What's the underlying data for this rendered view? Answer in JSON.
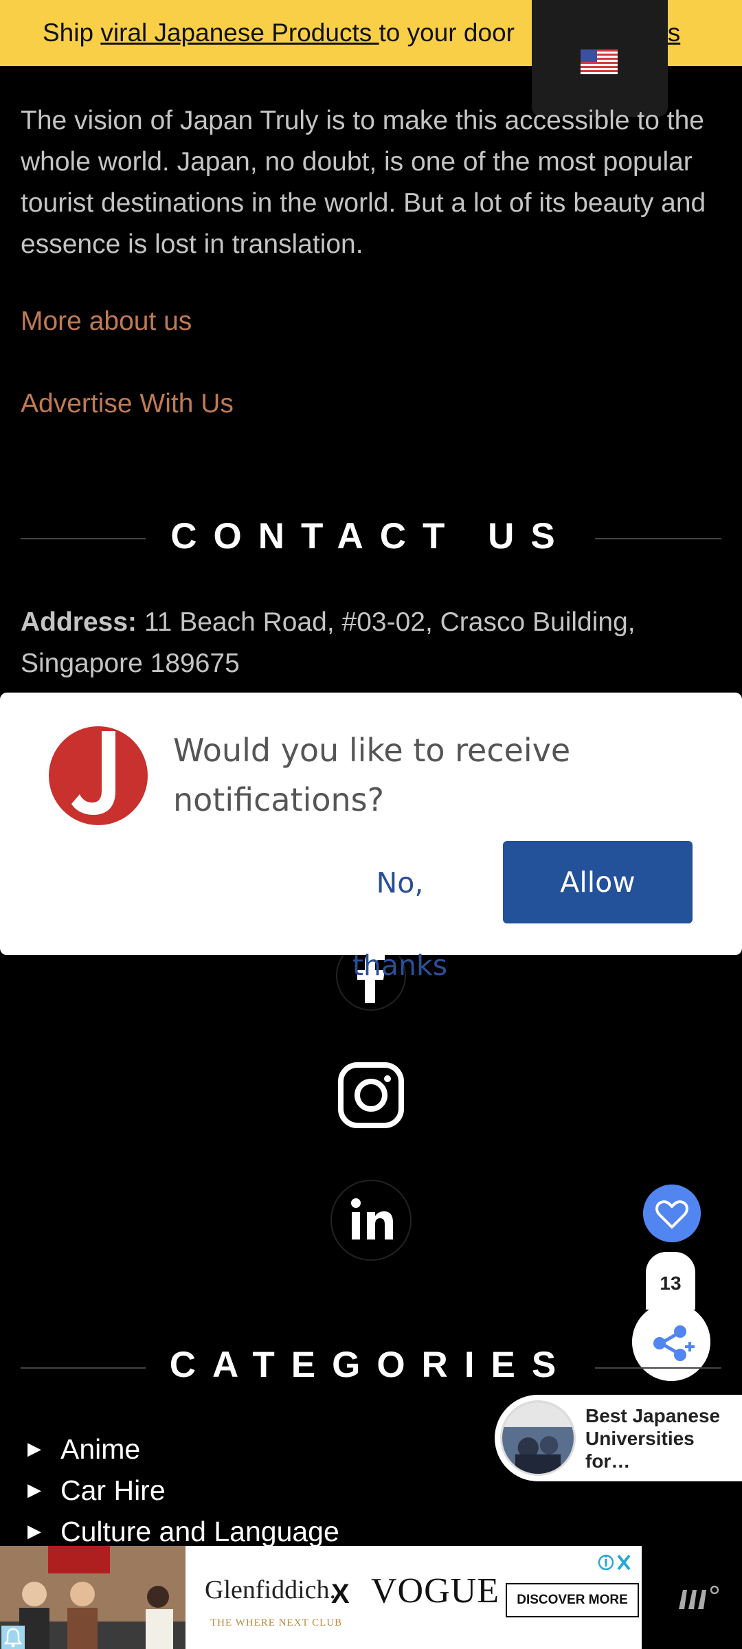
{
  "promo": {
    "prefix": "Ship ",
    "link": "viral Japanese Products ",
    "middle": "to your door",
    "suffix": "iss"
  },
  "language": {
    "flag": "us-flag-icon"
  },
  "about": {
    "vision": "The vision of Japan Truly is to make this accessible to the whole world. Japan, no doubt, is one of the most popular tourist destinations in the world. But a lot of its beauty and essence is lost in translation.",
    "more_about": "More about us",
    "advertise": "Advertise With Us"
  },
  "contact": {
    "title": "CONTACT US",
    "address_label": "Address:",
    "address_value": "11 Beach Road, #03-02, Crasco Building, Singapore 189675"
  },
  "notification": {
    "message": "Would you like to receive notifications?",
    "decline": "No, thanks",
    "accept": "Allow",
    "colors": {
      "accept_bg": "#23519a",
      "logo": "#c8312e"
    }
  },
  "social": [
    "facebook-icon",
    "instagram-icon",
    "linkedin-icon"
  ],
  "floating": {
    "like_count": "13"
  },
  "categories": {
    "title": "CATEGORIES",
    "items": [
      "Anime",
      "Car Hire",
      "Culture and Language"
    ]
  },
  "related": {
    "title": "Best Japanese Universities for…"
  },
  "ad": {
    "brand": "Glenfiddich.",
    "brand_sub": "THE WHERE NEXT CLUB",
    "x": "X",
    "partner": "VOGUE",
    "cta": "DISCOVER MORE"
  },
  "colors": {
    "banner": "#f9cf47",
    "link_orange": "#c07a52",
    "accent_blue": "#5185f0"
  }
}
